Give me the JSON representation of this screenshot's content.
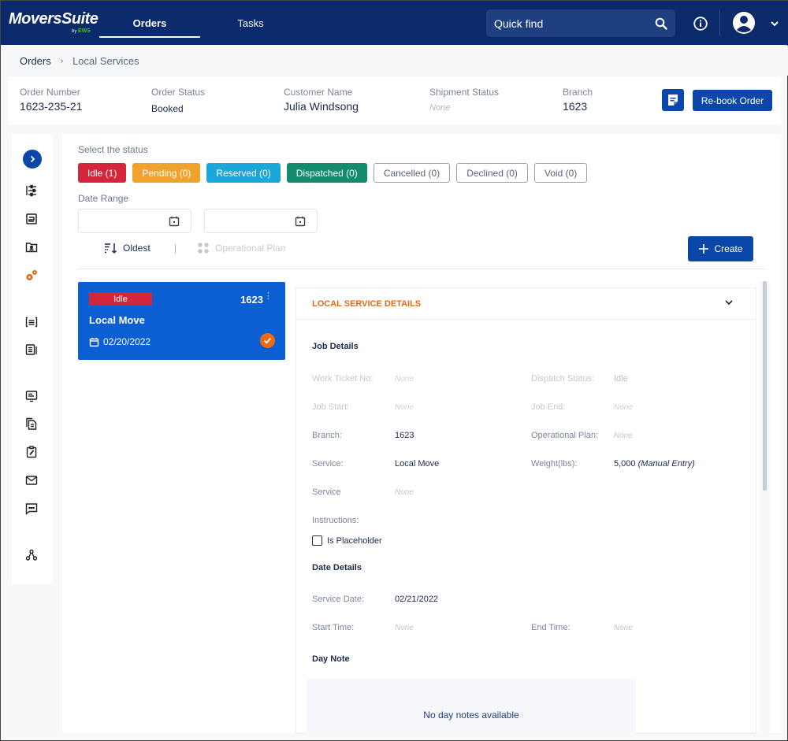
{
  "app": {
    "brand": "MoversSuite",
    "brand_by": "by",
    "brand_sub": "EWS"
  },
  "topnav": {
    "tabs": [
      {
        "label": "Orders",
        "active": true
      },
      {
        "label": "Tasks",
        "active": false
      }
    ],
    "search_placeholder": "Quick find",
    "icons": [
      "search-icon",
      "info-icon",
      "user-avatar-icon",
      "chevron-down-icon"
    ]
  },
  "breadcrumb": {
    "items": [
      "Orders",
      "Local Services"
    ],
    "separator": "›"
  },
  "order": {
    "fields": [
      {
        "label": "Order Number",
        "value": "1623-235-21"
      },
      {
        "label": "Order Status",
        "value": "Booked"
      },
      {
        "label": "Customer Name",
        "value": "Julia Windsong"
      },
      {
        "label": "Shipment Status",
        "value": "None"
      },
      {
        "label": "Branch",
        "value": "1623"
      }
    ],
    "rebook_label": "Re-book Order",
    "note_icon": "note-edit-icon"
  },
  "rail": {
    "icons": [
      "expand-icon",
      "list-settings-icon",
      "document-icon",
      "folder-user-icon",
      "gears-icon",
      "bracket-list-icon",
      "newspaper-icon",
      "monitor-icon",
      "copy-document-icon",
      "clipboard-edit-icon",
      "mail-icon",
      "chat-icon",
      "network-icon"
    ],
    "active": "gears-icon",
    "accent": "#e06a1b"
  },
  "filters": {
    "status_label": "Select the status",
    "statuses": [
      {
        "label": "Idle (1)",
        "color": "#d3263a"
      },
      {
        "label": "Pending (0)",
        "color": "#f1a22d"
      },
      {
        "label": "Reserved (0)",
        "color": "#1ba7d9"
      },
      {
        "label": "Dispatched (0)",
        "color": "#138c6c"
      },
      {
        "label": "Cancelled (0)",
        "color": null
      },
      {
        "label": "Declined (0)",
        "color": null
      },
      {
        "label": "Void (0)",
        "color": null
      }
    ],
    "date_range_label": "Date Range",
    "date_from": "",
    "date_to": "",
    "sort_label": "Oldest",
    "separator": "|",
    "operational_plan_label": "Operational Plan",
    "create_label": "Create"
  },
  "job_card": {
    "status": "Idle",
    "branch": "1623",
    "title": "Local Move",
    "date": "02/20/2022",
    "selected": true
  },
  "details": {
    "header": "LOCAL SERVICE DETAILS",
    "job_details_title": "Job Details",
    "work_ticket_label": "Work Ticket No:",
    "work_ticket_value": "None",
    "dispatch_status_label": "Dispatch Status:",
    "dispatch_status_value": "Idle",
    "job_start_label": "Job Start:",
    "job_start_value": "None",
    "job_end_label": "Job End:",
    "job_end_value": "None",
    "branch_label": "Branch:",
    "branch_value": "1623",
    "operational_plan_label": "Operational Plan:",
    "operational_plan_value": "None",
    "service_label": "Service:",
    "service_value": "Local Move",
    "weight_label": "Weight(lbs):",
    "weight_value": "5,000",
    "weight_note": "(Manual Entry)",
    "service2_label": "Service",
    "service2_value": "None",
    "instructions_label": "Instructions:",
    "is_placeholder_label": "Is Placeholder",
    "is_placeholder_checked": false,
    "date_details_title": "Date Details",
    "service_date_label": "Service Date:",
    "service_date_value": "02/21/2022",
    "start_time_label": "Start Time:",
    "start_time_value": "None",
    "end_time_label": "End Time:",
    "end_time_value": "None",
    "day_note_title": "Day Note",
    "day_note_empty": "No day notes available"
  }
}
